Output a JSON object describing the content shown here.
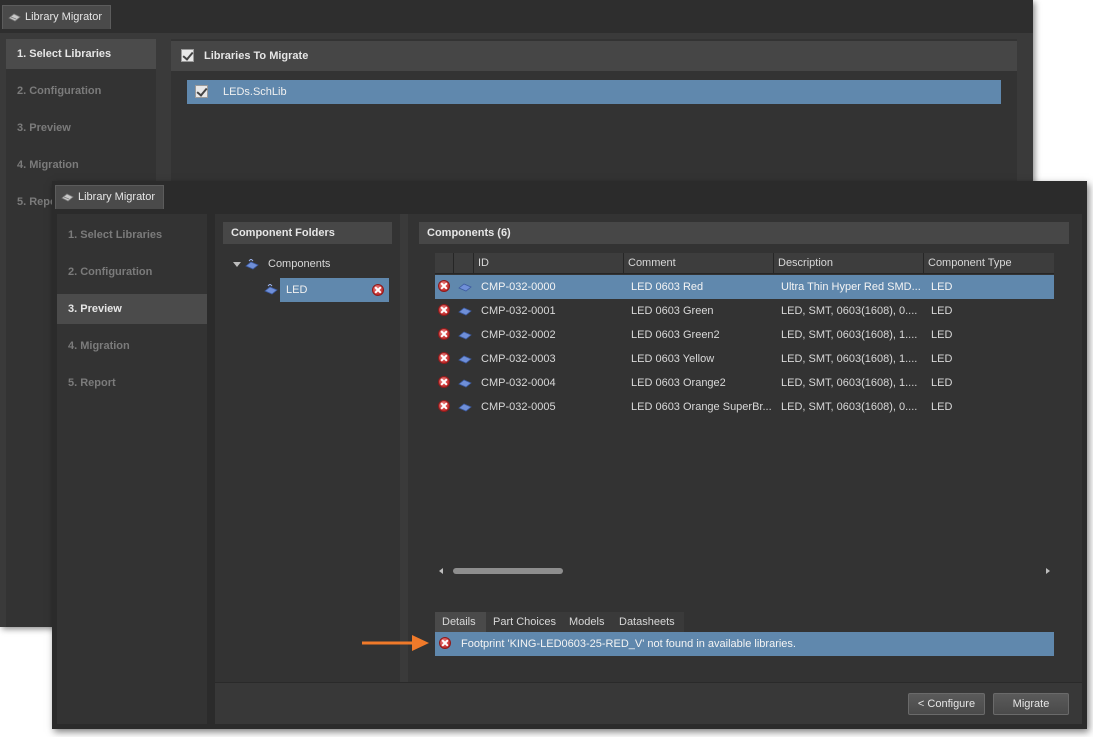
{
  "back_window": {
    "title": "Library Migrator",
    "nav": [
      "1. Select Libraries",
      "2. Configuration",
      "3. Preview",
      "4. Migration",
      "5. Report"
    ],
    "active_step": 0,
    "libraries_header": "Libraries To Migrate",
    "libraries": [
      {
        "name": "LEDs.SchLib",
        "checked": true
      }
    ]
  },
  "front_window": {
    "title": "Library Migrator",
    "nav": [
      "1. Select Libraries",
      "2. Configuration",
      "3. Preview",
      "4. Migration",
      "5. Report"
    ],
    "active_step": 2,
    "folders": {
      "header": "Component Folders",
      "root": "Components",
      "child": "LED"
    },
    "components": {
      "header": "Components (6)",
      "columns": [
        "ID",
        "Comment",
        "Description",
        "Component Type"
      ],
      "rows": [
        {
          "id": "CMP-032-0000",
          "comment": "LED 0603 Red",
          "description": "Ultra Thin Hyper Red SMD...",
          "type": "LED"
        },
        {
          "id": "CMP-032-0001",
          "comment": "LED 0603 Green",
          "description": "LED, SMT, 0603(1608), 0....",
          "type": "LED"
        },
        {
          "id": "CMP-032-0002",
          "comment": "LED 0603 Green2",
          "description": "LED, SMT, 0603(1608), 1....",
          "type": "LED"
        },
        {
          "id": "CMP-032-0003",
          "comment": "LED 0603 Yellow",
          "description": "LED, SMT, 0603(1608), 1....",
          "type": "LED"
        },
        {
          "id": "CMP-032-0004",
          "comment": "LED 0603 Orange2",
          "description": "LED, SMT, 0603(1608), 1....",
          "type": "LED"
        },
        {
          "id": "CMP-032-0005",
          "comment": "LED 0603 Orange SuperBr...",
          "description": "LED, SMT, 0603(1608), 0....",
          "type": "LED"
        }
      ],
      "selected_row": 0
    },
    "detail_tabs": [
      "Details",
      "Part Choices",
      "Models",
      "Datasheets"
    ],
    "active_detail_tab": 0,
    "message": "Footprint 'KING-LED0603-25-RED_V' not found in available libraries.",
    "buttons": {
      "configure": "< Configure",
      "migrate": "Migrate"
    }
  },
  "colors": {
    "selection": "#6088ad",
    "error": "#c42a2a",
    "callout_arrow": "#f07a2a"
  },
  "icons": [
    "library-migrator-icon",
    "error-icon",
    "component-icon",
    "checkbox-checked-icon"
  ]
}
